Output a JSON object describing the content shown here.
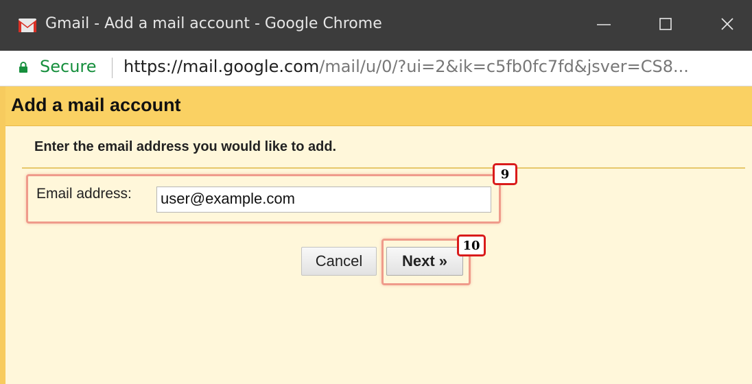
{
  "window": {
    "title": "Gmail - Add a mail account - Google Chrome",
    "controls": [
      "minimize-icon",
      "maximize-icon",
      "close-icon"
    ]
  },
  "addressbar": {
    "secure_label": "Secure",
    "url_host": "https://mail.google.com",
    "url_path": "/mail/u/0/?ui=2&ik=c5fb0fc7fd&jsver=CS8..."
  },
  "dialog": {
    "title": "Add a mail account",
    "instruction": "Enter the email address you would like to add.",
    "email_label": "Email address:",
    "email_value": "user@example.com",
    "cancel_label": "Cancel",
    "next_label": "Next »"
  },
  "annotations": {
    "step_email": "9",
    "step_next": "10"
  },
  "colors": {
    "titlebar": "#3c3c3c",
    "header": "#fad163",
    "body": "#fff7da",
    "secure_green": "#168f3d",
    "highlight": "#ef9b8b",
    "badge_border": "#d91b1b"
  }
}
